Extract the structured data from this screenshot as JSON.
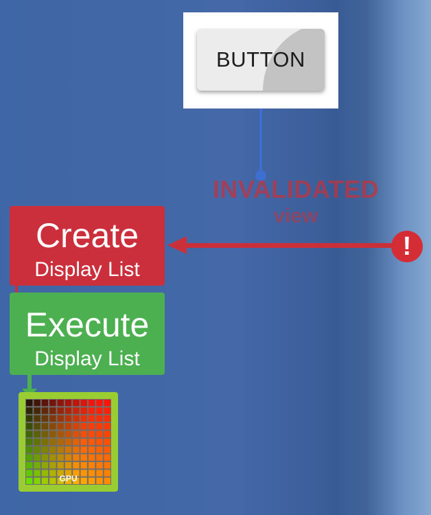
{
  "button_card": {
    "label": "BUTTON"
  },
  "invalidated": {
    "line1": "INVALIDATED",
    "line2": "view"
  },
  "alert": {
    "glyph": "!"
  },
  "create_box": {
    "title": "Create",
    "subtitle": "Display List"
  },
  "execute_box": {
    "title": "Execute",
    "subtitle": "Display List"
  },
  "gpu": {
    "label": "GPU"
  },
  "colors": {
    "create_red": "#cb2f3b",
    "execute_green": "#4caf50",
    "connector_blue": "#3d6fd0",
    "gpu_frame": "#9acd32"
  }
}
